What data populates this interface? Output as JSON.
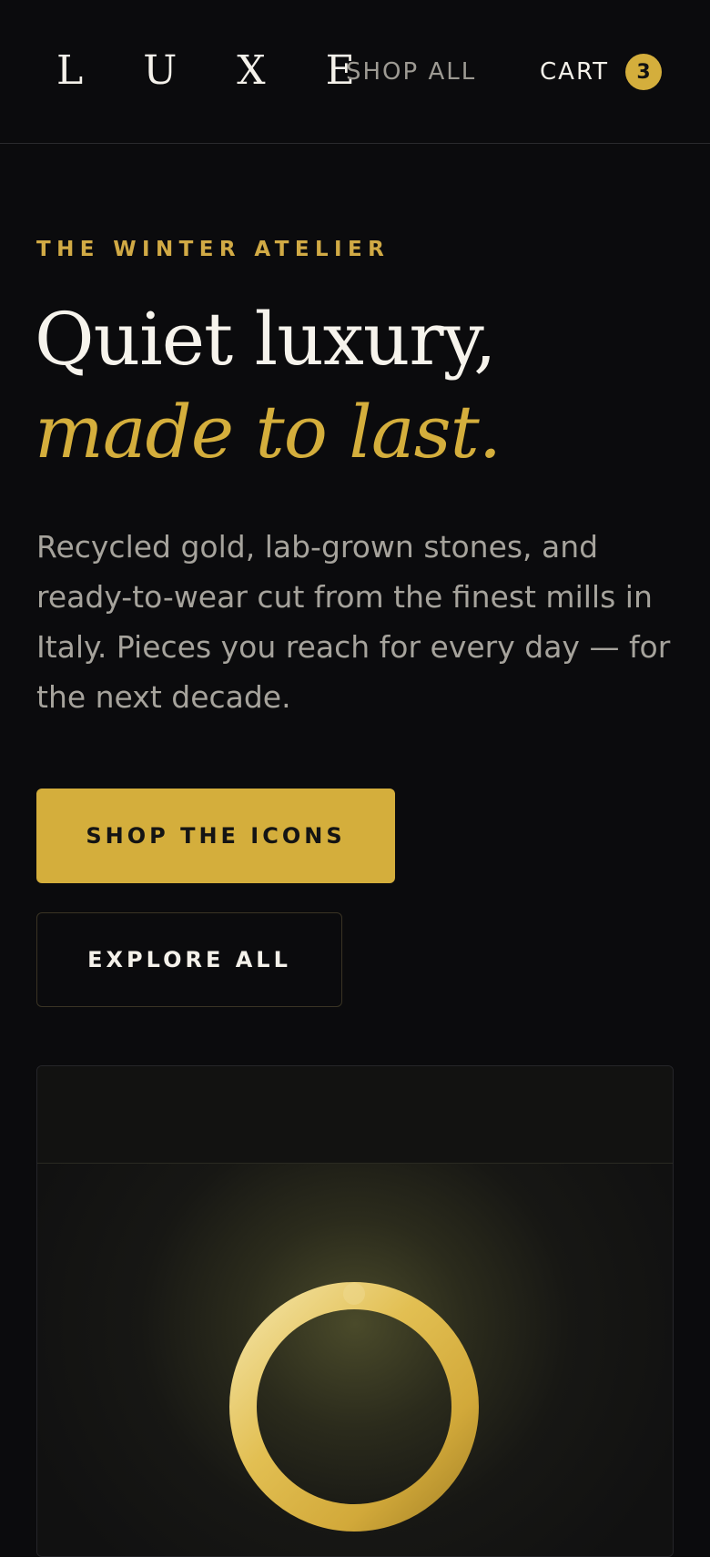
{
  "header": {
    "logo": "L U X E",
    "nav_shop_all": "SHOP ALL",
    "nav_cart": "CART",
    "cart_count": "3"
  },
  "hero": {
    "eyebrow": "THE WINTER ATELIER",
    "headline_line1": "Quiet luxury,",
    "headline_line2": "made to last.",
    "body": "Recycled gold, lab-grown stones, and ready-to-wear cut from the finest mills in Italy. Pieces you reach for every day — for the next decade.",
    "primary_cta": "SHOP THE ICONS",
    "secondary_cta": "EXPLORE ALL"
  },
  "product_card": {
    "image_icon": "gold-ring-icon"
  },
  "colors": {
    "background": "#0b0b0d",
    "accent_gold": "#d4ae3c",
    "text_primary": "#f4f1ea",
    "text_muted": "#a6a39c"
  }
}
